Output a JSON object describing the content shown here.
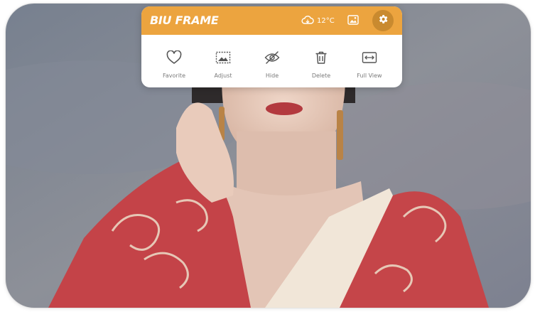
{
  "app": {
    "brand": "BIU FRAME"
  },
  "topbar": {
    "weather_icon": "cloud-weather-icon",
    "temperature": "12°C",
    "gallery_icon": "image-gallery-icon",
    "settings_icon": "gear-icon"
  },
  "actions": [
    {
      "label": "Favorite",
      "icon": "heart-icon"
    },
    {
      "label": "Adjust",
      "icon": "adjust-frame-icon"
    },
    {
      "label": "Hide",
      "icon": "eye-slash-icon"
    },
    {
      "label": "Delete",
      "icon": "trash-icon"
    },
    {
      "label": "Full View",
      "icon": "full-view-icon"
    }
  ],
  "colors": {
    "accent": "#eca43f",
    "accent_dark": "#c98a2f",
    "panel_bg": "#ffffff",
    "label_text": "#7a7a7a",
    "icon_stroke": "#555555"
  }
}
